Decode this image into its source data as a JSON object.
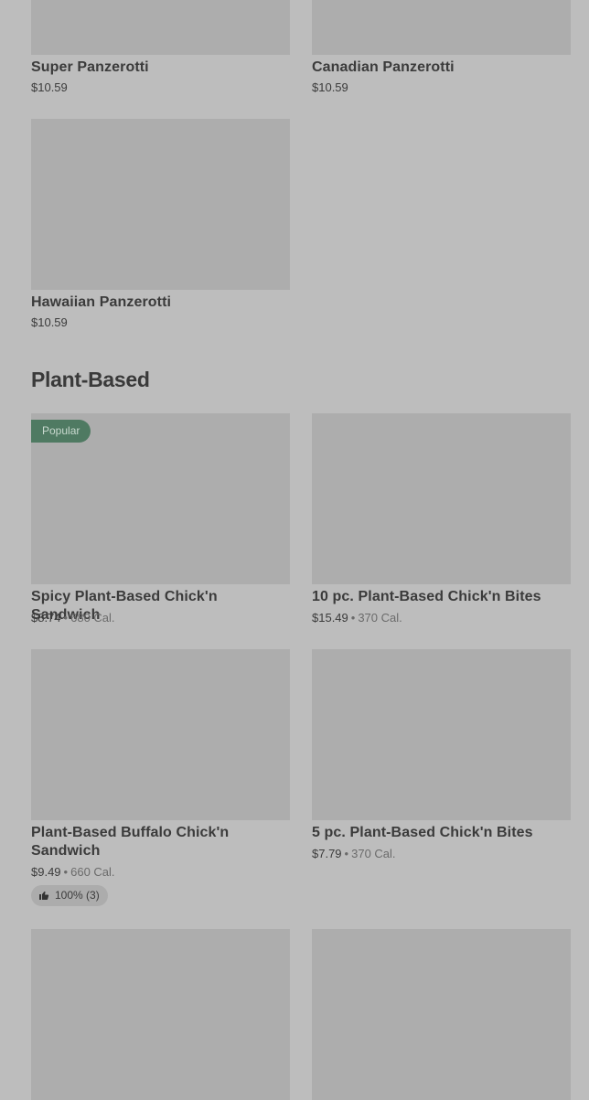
{
  "items": [
    {
      "name": "Super Panzerotti",
      "price": "$10.59"
    },
    {
      "name": "Canadian Panzerotti",
      "price": "$10.59"
    },
    {
      "name": "Hawaiian Panzerotti",
      "price": "$10.59"
    }
  ],
  "section": {
    "title": "Plant-Based"
  },
  "plant": [
    {
      "name": "Spicy Plant-Based Chick'n Sandwich",
      "price": "$8.74",
      "sep": "•",
      "cal": "680 Cal.",
      "badge": "Popular"
    },
    {
      "name": "10 pc. Plant-Based Chick'n Bites",
      "price": "$15.49",
      "sep": "•",
      "cal": "370 Cal."
    },
    {
      "name": "Plant-Based Buffalo Chick'n Sandwich",
      "price": "$9.49",
      "sep": "•",
      "cal": "660 Cal.",
      "rating": "100% (3)"
    },
    {
      "name": "5 pc. Plant-Based Chick'n Bites",
      "price": "$7.79",
      "sep": "•",
      "cal": "370 Cal."
    }
  ],
  "icons": {
    "thumbs_up": "thumbs-up-icon"
  }
}
